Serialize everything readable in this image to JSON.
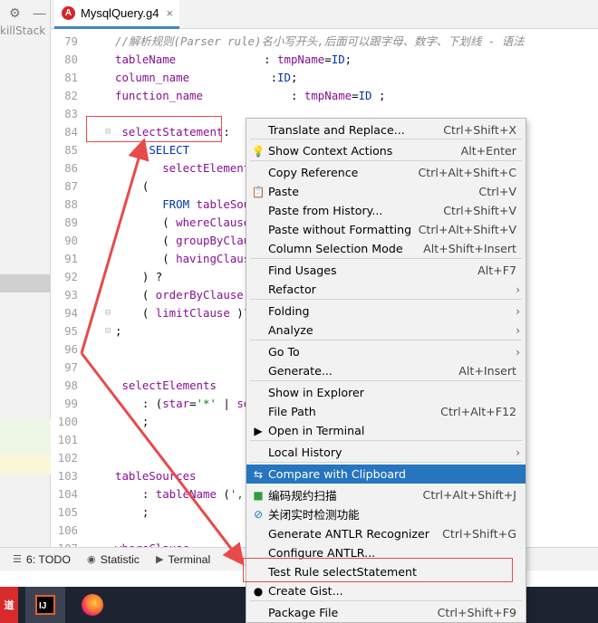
{
  "project": {
    "partial_text": "killStack"
  },
  "tab": {
    "title": "MysqlQuery.g4",
    "icon_letter": "A"
  },
  "editor": {
    "lines": [
      {
        "n": "79",
        "html": "<span class='c-comment'>//解析规则(Parser rule)名小写开头,后面可以跟字母、数字、下划线 - 语法</span>"
      },
      {
        "n": "80",
        "html": "<span class='c-rule'>tableName</span>             : <span class='c-rule'>tmpName</span>=<span class='c-tok'>ID</span>;"
      },
      {
        "n": "81",
        "html": "<span class='c-rule'>column_name</span>            :<span class='c-tok'>ID</span>;"
      },
      {
        "n": "82",
        "html": "<span class='c-rule'>function_name</span>             : <span class='c-rule'>tmpName</span>=<span class='c-tok'>ID</span> ;"
      },
      {
        "n": "83",
        "html": ""
      },
      {
        "n": "84",
        "html": " <span class='c-rule'>selectStatement</span>:"
      },
      {
        "n": "85",
        "html": "     <span class='c-kw'>SELECT</span>"
      },
      {
        "n": "86",
        "html": "       <span class='c-rule'>selectElements</span>"
      },
      {
        "n": "87",
        "html": "    ("
      },
      {
        "n": "88",
        "html": "       <span class='c-kw'>FROM</span> <span class='c-rule'>tableSources</span>"
      },
      {
        "n": "89",
        "html": "       ( <span class='c-rule'>whereClause</span> )?"
      },
      {
        "n": "90",
        "html": "       ( <span class='c-rule'>groupByClause</span> )?"
      },
      {
        "n": "91",
        "html": "       ( <span class='c-rule'>havingClause</span> )?"
      },
      {
        "n": "92",
        "html": "    ) ?"
      },
      {
        "n": "93",
        "html": "    ( <span class='c-rule'>orderByClause</span> )?"
      },
      {
        "n": "94",
        "html": "    ( <span class='c-rule'>limitClause</span> )? ;"
      },
      {
        "n": "95",
        "html": ";"
      },
      {
        "n": "96",
        "html": ""
      },
      {
        "n": "97",
        "html": ""
      },
      {
        "n": "98",
        "html": " <span class='c-rule'>selectElements</span>"
      },
      {
        "n": "99",
        "html": "    : (<span class='c-rule'>star</span>=<span class='c-str'>'*'</span> | <span class='c-rule'>sel</span>"
      },
      {
        "n": "100",
        "html": "    ;"
      },
      {
        "n": "101",
        "html": ""
      },
      {
        "n": "102",
        "html": ""
      },
      {
        "n": "103",
        "html": "<span class='c-rule'>tableSources</span>"
      },
      {
        "n": "104",
        "html": "    : <span class='c-rule'>tableName</span> (<span class='c-str'>','</span>"
      },
      {
        "n": "105",
        "html": "    ;"
      },
      {
        "n": "106",
        "html": ""
      },
      {
        "n": "107",
        "html": "<span class='c-rule'>whereClause</span>"
      }
    ],
    "header_partial": "//  ... parser  ...语法"
  },
  "tool_windows": [
    {
      "icon": "☰",
      "label": "6: TODO"
    },
    {
      "icon": "◉",
      "label": "Statistic"
    },
    {
      "icon": "▶",
      "label": "Terminal"
    }
  ],
  "taskbar": {
    "youdao_text": "道",
    "intellij_text": "IJ"
  },
  "context_menu": {
    "items": [
      {
        "label": "Translate and Replace...",
        "shortcut": "Ctrl+Shift+X",
        "icon": ""
      },
      {
        "label": "Show Context Actions",
        "shortcut": "Alt+Enter",
        "icon": "💡"
      },
      {
        "label": "Copy Reference",
        "shortcut": "Ctrl+Alt+Shift+C",
        "icon": ""
      },
      {
        "label": "Paste",
        "shortcut": "Ctrl+V",
        "icon": "📋"
      },
      {
        "label": "Paste from History...",
        "shortcut": "Ctrl+Shift+V",
        "icon": ""
      },
      {
        "label": "Paste without Formatting",
        "shortcut": "Ctrl+Alt+Shift+V",
        "icon": ""
      },
      {
        "label": "Column Selection Mode",
        "shortcut": "Alt+Shift+Insert",
        "icon": ""
      },
      {
        "label": "Find Usages",
        "shortcut": "Alt+F7",
        "icon": ""
      },
      {
        "label": "Refactor",
        "shortcut": "",
        "icon": ""
      },
      {
        "label": "Folding",
        "shortcut": "",
        "icon": ""
      },
      {
        "label": "Analyze",
        "shortcut": "",
        "icon": ""
      },
      {
        "label": "Go To",
        "shortcut": "",
        "icon": ""
      },
      {
        "label": "Generate...",
        "shortcut": "Alt+Insert",
        "icon": ""
      },
      {
        "label": "Show in Explorer",
        "shortcut": "",
        "icon": ""
      },
      {
        "label": "File Path",
        "shortcut": "Ctrl+Alt+F12",
        "icon": ""
      },
      {
        "label": "Open in Terminal",
        "shortcut": "",
        "icon": "▶"
      },
      {
        "label": "Local History",
        "shortcut": "",
        "icon": ""
      },
      {
        "label": "Compare with Clipboard",
        "shortcut": "",
        "icon": "⇆"
      },
      {
        "label": "编码规约扫描",
        "shortcut": "Ctrl+Alt+Shift+J",
        "icon": "■"
      },
      {
        "label": "关闭实时检测功能",
        "shortcut": "",
        "icon": "⊘"
      },
      {
        "label": "Generate ANTLR Recognizer",
        "shortcut": "Ctrl+Shift+G",
        "icon": ""
      },
      {
        "label": "Configure ANTLR...",
        "shortcut": "",
        "icon": ""
      },
      {
        "label": "Test Rule selectStatement",
        "shortcut": "",
        "icon": ""
      },
      {
        "label": "Create Gist...",
        "shortcut": "",
        "icon": "●"
      },
      {
        "label": "Package File",
        "shortcut": "Ctrl+Shift+F9",
        "icon": ""
      }
    ]
  },
  "colors": {
    "menu_highlight": "#2675bf",
    "annotation_red": "#e84a4a",
    "tab_underline": "#4083c9"
  }
}
